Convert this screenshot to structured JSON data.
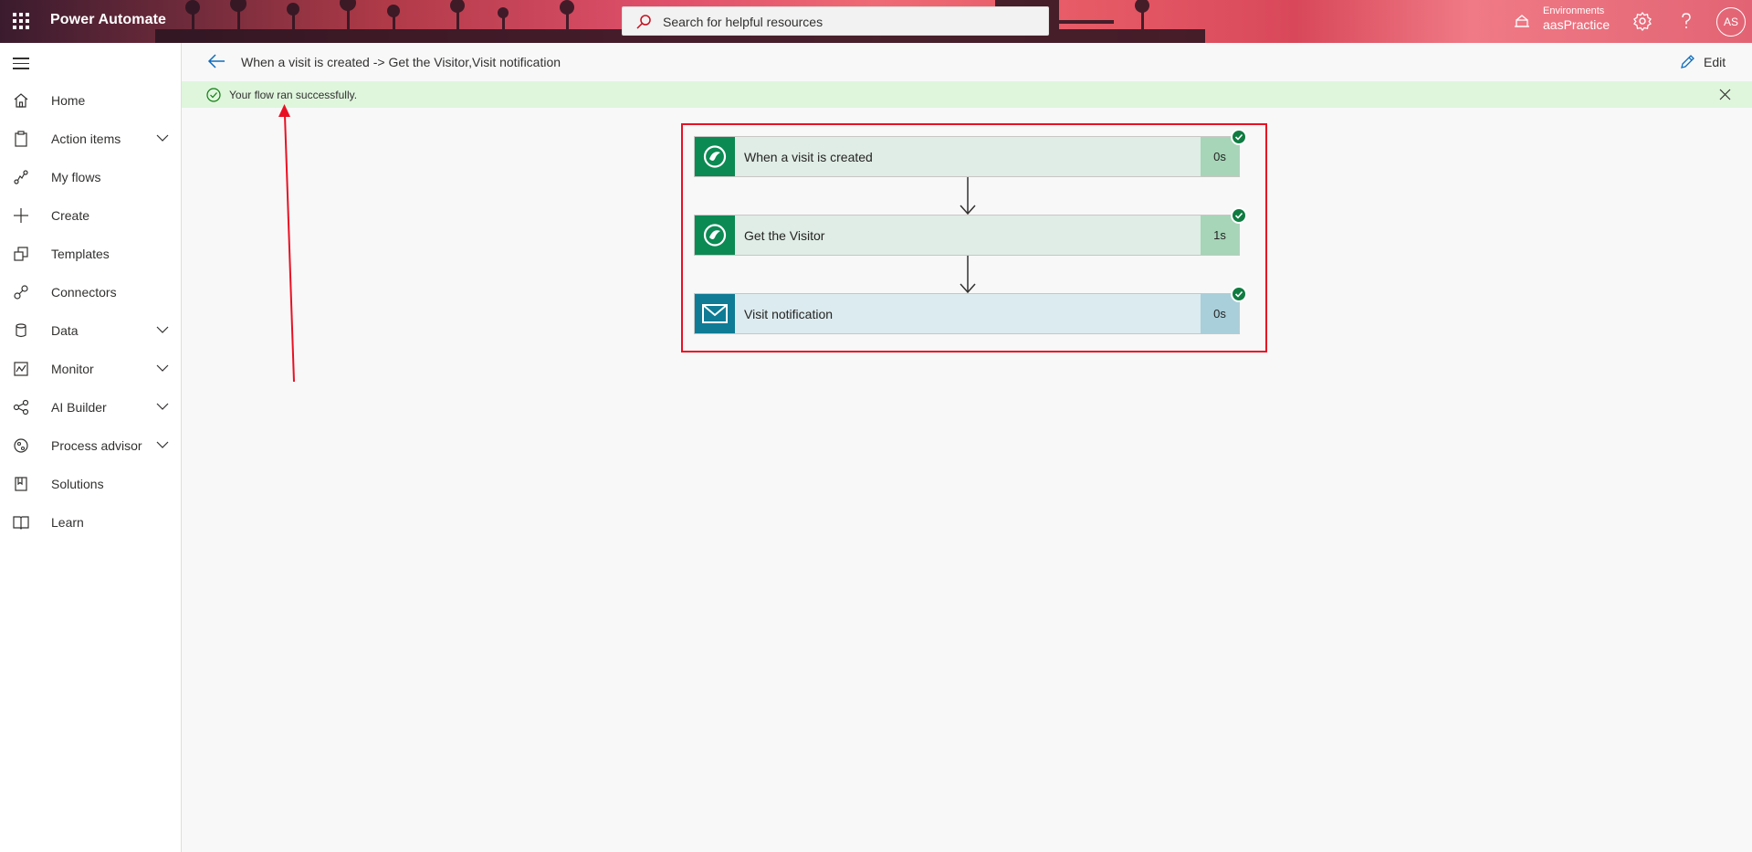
{
  "header": {
    "app_title": "Power Automate",
    "search_placeholder": "Search for helpful resources",
    "environment_label": "Environments",
    "environment_value": "aasPractice",
    "avatar_initials": "AS"
  },
  "sidebar": {
    "items": [
      {
        "label": "Home",
        "icon": "home-icon",
        "expandable": false
      },
      {
        "label": "Action items",
        "icon": "clipboard-icon",
        "expandable": true
      },
      {
        "label": "My flows",
        "icon": "flows-icon",
        "expandable": false
      },
      {
        "label": "Create",
        "icon": "plus-icon",
        "expandable": false
      },
      {
        "label": "Templates",
        "icon": "templates-icon",
        "expandable": false
      },
      {
        "label": "Connectors",
        "icon": "connectors-icon",
        "expandable": false
      },
      {
        "label": "Data",
        "icon": "database-icon",
        "expandable": true
      },
      {
        "label": "Monitor",
        "icon": "monitor-icon",
        "expandable": true
      },
      {
        "label": "AI Builder",
        "icon": "ai-builder-icon",
        "expandable": true
      },
      {
        "label": "Process advisor",
        "icon": "process-advisor-icon",
        "expandable": true
      },
      {
        "label": "Solutions",
        "icon": "solutions-icon",
        "expandable": false
      },
      {
        "label": "Learn",
        "icon": "book-icon",
        "expandable": false
      }
    ]
  },
  "command_bar": {
    "flow_title": "When a visit is created -> Get the Visitor,Visit notification",
    "edit_label": "Edit"
  },
  "banner": {
    "message": "Your flow ran successfully."
  },
  "flow_steps": [
    {
      "name": "When a visit is created",
      "duration": "0s",
      "connector": "dataverse-icon",
      "status": "succeeded"
    },
    {
      "name": "Get the Visitor",
      "duration": "1s",
      "connector": "dataverse-icon",
      "status": "succeeded"
    },
    {
      "name": "Visit notification",
      "duration": "0s",
      "connector": "mail-icon",
      "status": "succeeded"
    }
  ],
  "colors": {
    "success_banner": "#dff6dd",
    "dataverse_green": "#0b8a53",
    "mail_teal": "#0f7b95",
    "annotation_red": "#e81123"
  }
}
